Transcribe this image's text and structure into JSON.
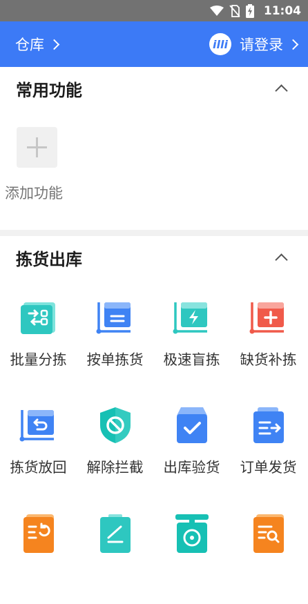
{
  "status_bar": {
    "time": "11:04"
  },
  "header": {
    "warehouse_label": "仓库",
    "login_label": "请登录",
    "logo_text": "illi"
  },
  "section_common": {
    "title": "常用功能",
    "add_label": "添加功能"
  },
  "section_picking": {
    "title": "拣货出库",
    "items": [
      {
        "label": "批量分拣",
        "icon": "batch-sort-icon",
        "color": "#2ec7c0"
      },
      {
        "label": "按单拣货",
        "icon": "order-pick-icon",
        "color": "#3f83f4"
      },
      {
        "label": "极速盲拣",
        "icon": "fast-blind-pick-icon",
        "color": "#2ec7c0"
      },
      {
        "label": "缺货补拣",
        "icon": "shortage-repick-icon",
        "color": "#f05a4a"
      },
      {
        "label": "拣货放回",
        "icon": "pick-return-icon",
        "color": "#3f83f4"
      },
      {
        "label": "解除拦截",
        "icon": "release-intercept-icon",
        "color": "#17c0b4"
      },
      {
        "label": "出库验货",
        "icon": "outbound-inspect-icon",
        "color": "#3f83f4"
      },
      {
        "label": "订单发货",
        "icon": "order-ship-icon",
        "color": "#3f83f4"
      },
      {
        "label": "",
        "icon": "refresh-doc-icon",
        "color": "#f5841f"
      },
      {
        "label": "",
        "icon": "edit-doc-icon",
        "color": "#2ec7c0"
      },
      {
        "label": "",
        "icon": "scale-icon",
        "color": "#17c0b4"
      },
      {
        "label": "",
        "icon": "search-doc-icon",
        "color": "#f5841f"
      }
    ]
  }
}
